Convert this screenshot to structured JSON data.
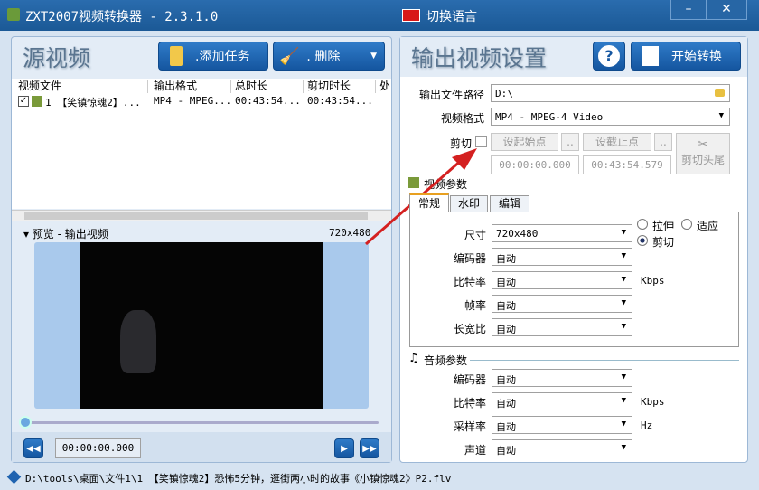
{
  "title": "ZXT2007视频转换器 - 2.3.1.0",
  "language": "切换语言",
  "left": {
    "heading": "源视频",
    "add_task": ".添加任务",
    "delete": ".  删除",
    "columns": [
      "视频文件",
      "输出格式",
      "总时长",
      "剪切时长",
      "处"
    ],
    "rows": [
      {
        "name": "1 【笑镇惊魂2】...",
        "format": "MP4 - MPEG...",
        "total": "00:43:54...",
        "cut": "00:43:54..."
      }
    ],
    "preview_label": "预览 - 输出视频",
    "preview_size": "720x480",
    "time": "00:00:00.000",
    "progress": 0
  },
  "right": {
    "heading": "输出视频设置",
    "start": "开始转换",
    "path_label": "输出文件路径",
    "path": "D:\\",
    "format_label": "视频格式",
    "format": "MP4 - MPEG-4 Video",
    "cut_label": "剪切",
    "set_start": "设起始点",
    "set_end": "设截止点",
    "dots": "..",
    "start_time": "00:00:00.000",
    "end_time": "00:43:54.579",
    "cut_ends": "剪切头尾",
    "video_params": "视频参数",
    "tabs": [
      "常规",
      "水印",
      "编辑"
    ],
    "size_label": "尺寸",
    "size": "720x480",
    "stretch": "拉伸",
    "fit": "适应",
    "crop": "剪切",
    "vfields": [
      {
        "label": "编码器",
        "value": "自动",
        "unit": ""
      },
      {
        "label": "比特率",
        "value": "自动",
        "unit": "Kbps"
      },
      {
        "label": "帧率",
        "value": "自动",
        "unit": ""
      },
      {
        "label": "长宽比",
        "value": "自动",
        "unit": ""
      }
    ],
    "audio_params": "音频参数",
    "afields": [
      {
        "label": "编码器",
        "value": "自动",
        "unit": ""
      },
      {
        "label": "比特率",
        "value": "自动",
        "unit": "Kbps"
      },
      {
        "label": "采样率",
        "value": "自动",
        "unit": "Hz"
      },
      {
        "label": "声道",
        "value": "自动",
        "unit": ""
      }
    ]
  },
  "status": "D:\\tools\\桌面\\文件1\\1 【笑镇惊魂2】恐怖5分钟，逛街两小时的故事《小镇惊魂2》P2.flv"
}
